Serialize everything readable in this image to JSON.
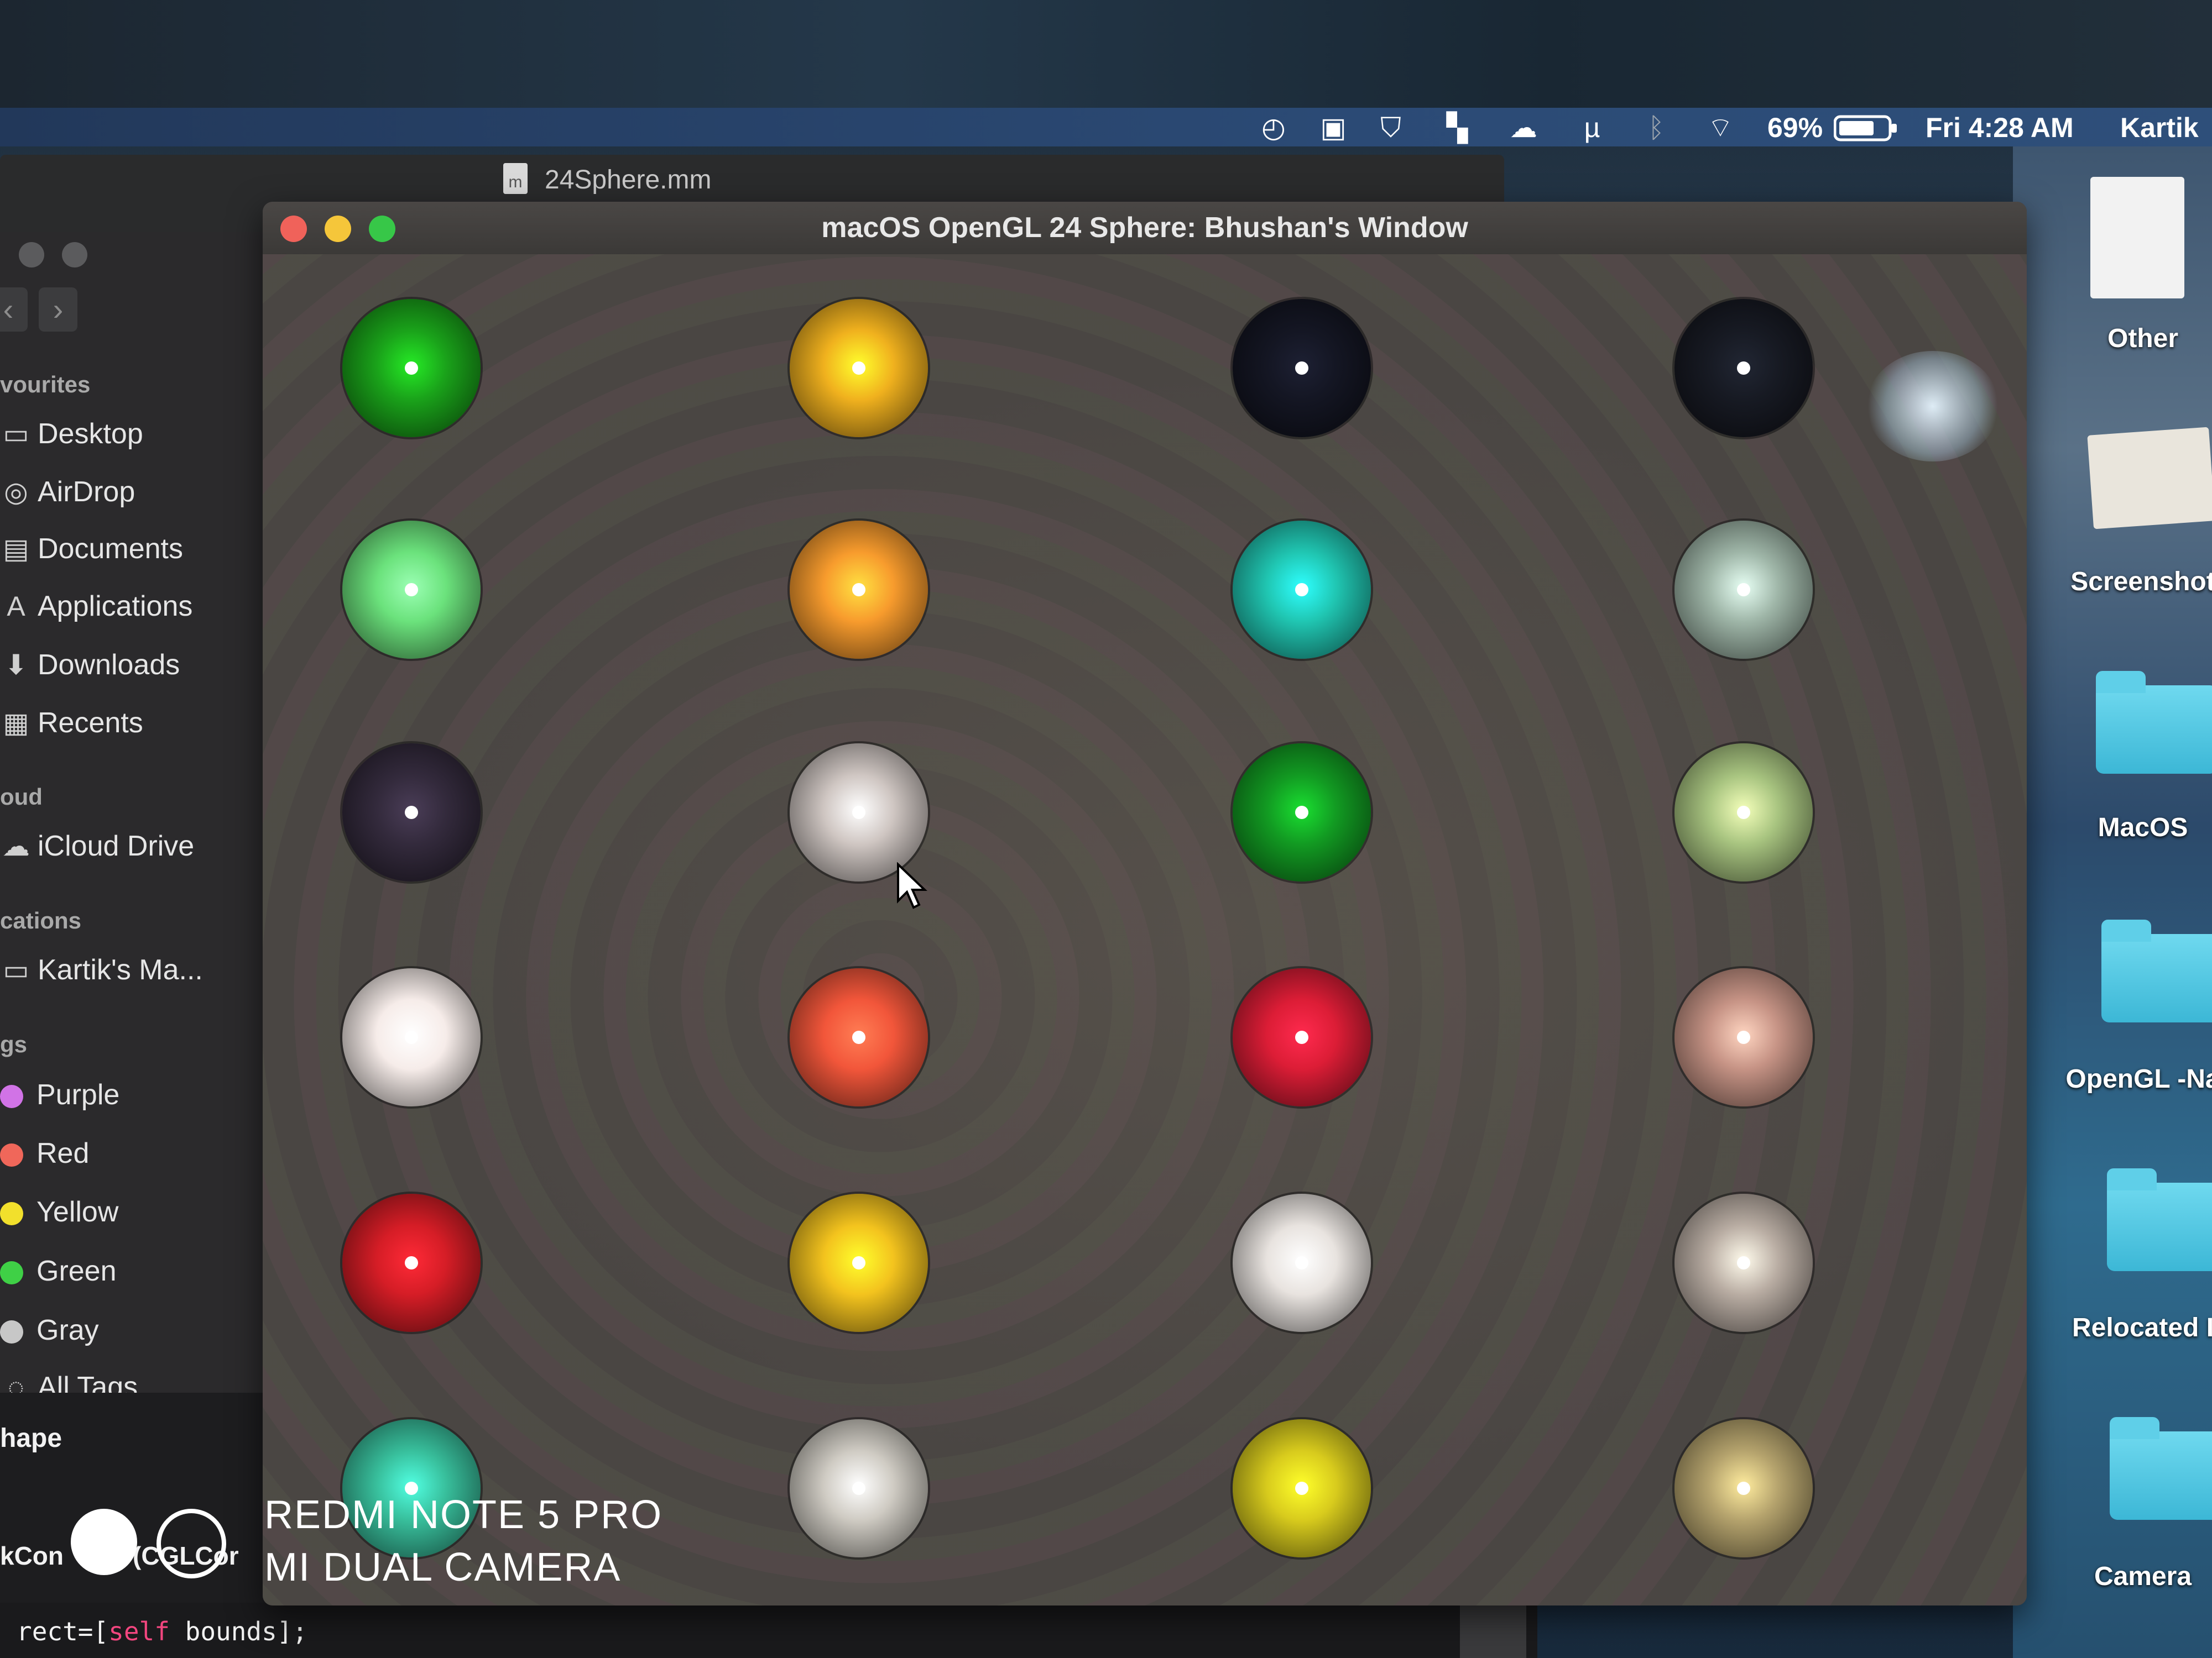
{
  "menubar": {
    "battery": "69%",
    "clock": "Fri 4:28 AM",
    "user": "Kartik",
    "icons": [
      "timemachine-icon",
      "contacts-icon",
      "shield-icon",
      "layout-icon",
      "cloud-icon",
      "utorrent-icon",
      "bluetooth-icon",
      "wifi-icon",
      "battery-icon"
    ]
  },
  "editor": {
    "tab_title": "24Sphere.mm",
    "file_glyph": "m"
  },
  "finder": {
    "sections": {
      "favourites": "vourites",
      "icloud": "oud",
      "locations": "cations",
      "tags": "gs"
    },
    "favourites": [
      "Desktop",
      "AirDrop",
      "Documents",
      "Applications",
      "Downloads",
      "Recents"
    ],
    "icloud": [
      "iCloud Drive"
    ],
    "locations": [
      "Kartik's Ma..."
    ],
    "tags": [
      {
        "label": "Purple",
        "color": "#d173e6"
      },
      {
        "label": "Red",
        "color": "#f0675a"
      },
      {
        "label": "Yellow",
        "color": "#f2e02c"
      },
      {
        "label": "Green",
        "color": "#3fd046"
      },
      {
        "label": "Gray",
        "color": "#c7c7c7"
      }
    ],
    "all_tags": "All Tags"
  },
  "code": {
    "line1": "hape",
    "line2": "kCon",
    "line2b": "(CGLCor",
    "line3_pre": "rect=[",
    "line3_kw": "self",
    "line3_post": " bounds];"
  },
  "window": {
    "title": "macOS OpenGL 24 Sphere:  Bhushan's Window",
    "traffic_lights": {
      "close": "#f0625a",
      "minimize": "#f5c63a",
      "zoom": "#37c748"
    }
  },
  "spheres": [
    [
      "#1aa21a",
      "#f0b11e",
      "#141623",
      "#171a23"
    ],
    [
      "#6be27c",
      "#f79b2d",
      "#20c6b2",
      "#9fb6a8"
    ],
    [
      "#332a3c",
      "#cfc6c2",
      "#129a22",
      "#a8c480"
    ],
    [
      "#f6ece9",
      "#f2563a",
      "#dc1d36",
      "#c69385"
    ],
    [
      "#d51d26",
      "#f3c31e",
      "#e8e3df",
      "#b9ada3"
    ],
    [
      "#38bf9c",
      "#cfcbc3",
      "#d8cb1d",
      "#b5a36d"
    ]
  ],
  "desktop": {
    "items": [
      "Other",
      "Screenshot",
      "MacOS",
      "OpenGL -Na",
      "Relocated I",
      "Camera"
    ]
  },
  "watermark": {
    "line1": "REDMI NOTE 5 PRO",
    "line2": "MI DUAL CAMERA"
  }
}
